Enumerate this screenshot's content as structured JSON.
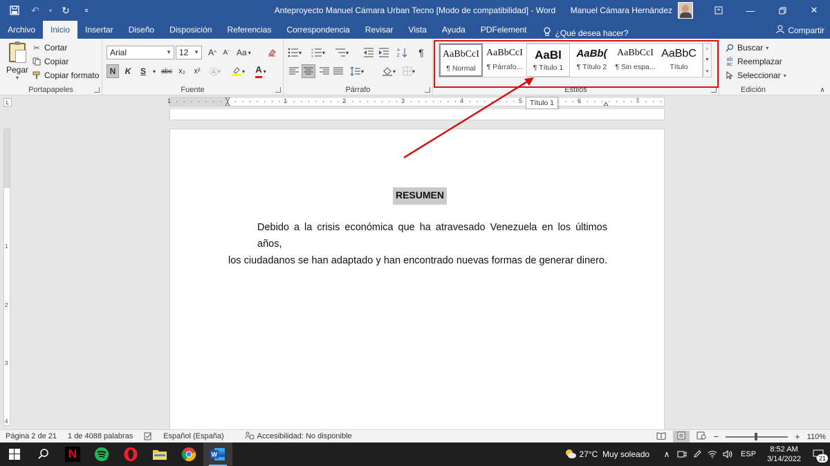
{
  "window": {
    "document_title": "Anteproyecto Manuel Cámara  Urban Tecno [Modo de compatibilidad]  -  Word",
    "user_name": "Manuel Cámara Hernández"
  },
  "tabs": [
    "Archivo",
    "Inicio",
    "Insertar",
    "Diseño",
    "Disposición",
    "Referencias",
    "Correspondencia",
    "Revisar",
    "Vista",
    "Ayuda",
    "PDFelement"
  ],
  "tell_me": "¿Qué desea hacer?",
  "share_label": "Compartir",
  "clipboard": {
    "paste": "Pegar",
    "cut": "Cortar",
    "copy": "Copiar",
    "format_painter": "Copiar formato",
    "label": "Portapapeles"
  },
  "font": {
    "name": "Arial",
    "size": "12",
    "bold": "N",
    "italic": "K",
    "underline": "S",
    "strike": "abc",
    "subscript": "x₂",
    "superscript": "x²",
    "case": "Aa",
    "label": "Fuente"
  },
  "paragraph": {
    "label": "Párrafo"
  },
  "styles": {
    "label": "Estilos",
    "items": [
      {
        "sample": "AaBbCcI",
        "name": "¶ Normal"
      },
      {
        "sample": "AaBbCcI",
        "name": "¶ Párrafo..."
      },
      {
        "sample": "AaBl",
        "name": "¶ Título 1"
      },
      {
        "sample": "AaBb(",
        "name": "¶ Título 2"
      },
      {
        "sample": "AaBbCcI",
        "name": "¶ Sin espa..."
      },
      {
        "sample": "AaBbC",
        "name": "Título"
      }
    ]
  },
  "editing": {
    "find": "Buscar",
    "replace": "Reemplazar",
    "select": "Seleccionar",
    "label": "Edición"
  },
  "tooltip": "Título 1",
  "ruler_numbers": [
    "1",
    "1",
    "2",
    "3",
    "4",
    "5",
    "6",
    "7"
  ],
  "vruler_numbers": [
    "1",
    "2",
    "3",
    "4"
  ],
  "document": {
    "heading": "RESUMEN",
    "para_line1": "Debido a la crisis económica que ha atravesado Venezuela en los últimos años,",
    "para_line2": "los ciudadanos se han adaptado y han encontrado nuevas formas de generar dinero."
  },
  "status": {
    "page": "Página 2 de 21",
    "words": "1 de 4088 palabras",
    "language": "Español (España)",
    "accessibility": "Accesibilidad: No disponible",
    "zoom": "110%"
  },
  "taskbar": {
    "weather": "27°C  Muy soleado",
    "lang": "ESP",
    "time": "8:52 AM",
    "date": "3/14/2022",
    "notifications": "21"
  },
  "colors": {
    "word_blue": "#2b579a",
    "annotation_red": "#d11111"
  }
}
